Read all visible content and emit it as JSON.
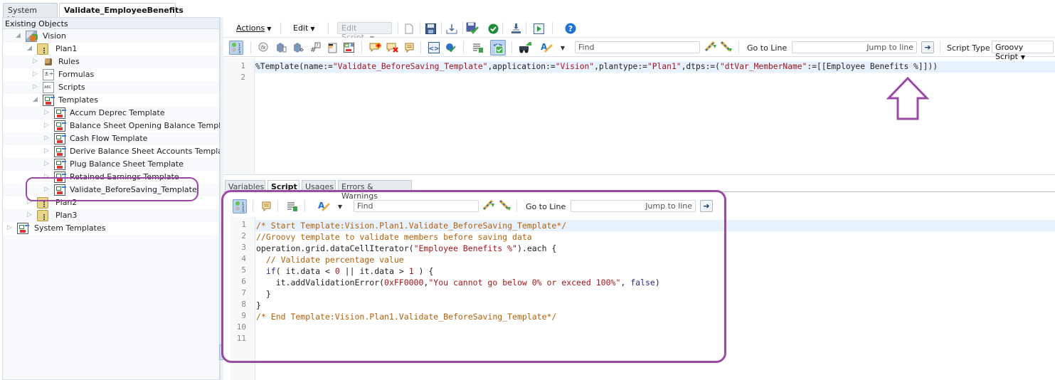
{
  "window_tabs": [
    {
      "label": "System View",
      "active": false
    },
    {
      "label": "Validate_EmployeeBenefits",
      "active": true
    }
  ],
  "left_panel": {
    "header": "Existing Objects",
    "tree": [
      {
        "label": "Vision",
        "level": 0,
        "expanded": true,
        "icon": "application-icon"
      },
      {
        "label": "Plan1",
        "level": 1,
        "expanded": true,
        "icon": "plan-icon"
      },
      {
        "label": "Rules",
        "level": 2,
        "expanded": false,
        "icon": "rules-icon"
      },
      {
        "label": "Formulas",
        "level": 2,
        "expanded": false,
        "icon": "formulas-icon"
      },
      {
        "label": "Scripts",
        "level": 2,
        "expanded": false,
        "icon": "scripts-icon"
      },
      {
        "label": "Templates",
        "level": 2,
        "expanded": true,
        "icon": "templates-icon"
      },
      {
        "label": "Accum Deprec Template",
        "level": 3,
        "expanded": false,
        "icon": "template-icon"
      },
      {
        "label": "Balance Sheet Opening Balance Template",
        "level": 3,
        "expanded": false,
        "icon": "template-icon"
      },
      {
        "label": "Cash Flow Template",
        "level": 3,
        "expanded": false,
        "icon": "template-icon"
      },
      {
        "label": "Derive Balance Sheet Accounts Template",
        "level": 3,
        "expanded": false,
        "icon": "template-icon"
      },
      {
        "label": "Plug Balance Sheet Template",
        "level": 3,
        "expanded": false,
        "icon": "template-icon"
      },
      {
        "label": "Retained Earnings Template",
        "level": 3,
        "expanded": false,
        "icon": "template-icon"
      },
      {
        "label": "Validate_BeforeSaving_Template",
        "level": 3,
        "expanded": false,
        "icon": "template-icon",
        "highlighted": true
      },
      {
        "label": "Plan2",
        "level": 1,
        "expanded": false,
        "icon": "plan-icon"
      },
      {
        "label": "Plan3",
        "level": 1,
        "expanded": false,
        "icon": "plan-icon"
      },
      {
        "label": "System Templates",
        "level": 0,
        "expanded": false,
        "icon": "templates-icon"
      }
    ]
  },
  "toolbar_main": {
    "actions_label": "Actions",
    "edit_label": "Edit",
    "edit_script_label": "Edit Script",
    "icons": [
      "new-icon",
      "save-icon",
      "download-icon",
      "save-validate-icon",
      "validate-icon",
      "deploy-icon",
      "launch-icon",
      "help-icon"
    ]
  },
  "toolbar_editor": {
    "find_placeholder": "Find",
    "go_to_line_label": "Go to Line",
    "jump_placeholder": "Jump to line",
    "script_type_label": "Script Type",
    "script_type_value": "Groovy Script",
    "icons": [
      "line-numbers-icon",
      "function-icon",
      "member-icon",
      "member-range-icon",
      "variable-icon",
      "rtp-icon",
      "template-icon",
      "add-comment-icon",
      "remove-comment-icon",
      "comment-icon",
      "code-block-icon",
      "syntax-check-icon",
      "format-icon",
      "syntax-icon",
      "debug-icon",
      "color-theme-icon",
      "find-next-icon",
      "find-prev-icon",
      "go-icon"
    ]
  },
  "editor_top": {
    "lines": [
      {
        "n": "1",
        "parts": [
          {
            "t": "%Template(name:=",
            "c": ""
          },
          {
            "t": "\"Validate_BeforeSaving_Template\"",
            "c": "s"
          },
          {
            "t": ",application:=",
            "c": ""
          },
          {
            "t": "\"Vision\"",
            "c": "s"
          },
          {
            "t": ",plantype:=",
            "c": ""
          },
          {
            "t": "\"Plan1\"",
            "c": "s"
          },
          {
            "t": ",dtps:=(",
            "c": ""
          },
          {
            "t": "\"dtVar_MemberName\"",
            "c": "s"
          },
          {
            "t": ":=[[Employee Benefits %]]))",
            "c": ""
          }
        ]
      },
      {
        "n": "2",
        "parts": []
      }
    ]
  },
  "sub_tabs": [
    {
      "label": "Variables",
      "active": false
    },
    {
      "label": "Script",
      "active": true
    },
    {
      "label": "Usages",
      "active": false
    },
    {
      "label": "Errors & Warnings",
      "active": false
    }
  ],
  "toolbar_script": {
    "find_placeholder": "Find",
    "go_to_line_label": "Go to Line",
    "jump_placeholder": "Jump to line"
  },
  "editor_bottom": {
    "lines": [
      {
        "n": "1",
        "parts": [
          {
            "t": "/* Start Template:Vision.Plan1.Validate_BeforeSaving_Template*/",
            "c": "cm"
          }
        ]
      },
      {
        "n": "2",
        "parts": [
          {
            "t": "//Groovy template to validate members before saving data",
            "c": "cm"
          }
        ]
      },
      {
        "n": "3",
        "parts": [
          {
            "t": "operation.grid.dataCellIterator(",
            "c": ""
          },
          {
            "t": "\"Employee Benefits %\"",
            "c": "s"
          },
          {
            "t": ").each {",
            "c": ""
          }
        ]
      },
      {
        "n": "4",
        "parts": [
          {
            "t": "  // Validate percentage value",
            "c": "cm"
          }
        ]
      },
      {
        "n": "5",
        "parts": [
          {
            "t": "  ",
            "c": ""
          },
          {
            "t": "if",
            "c": "kw"
          },
          {
            "t": "( it.data < ",
            "c": ""
          },
          {
            "t": "0",
            "c": "s"
          },
          {
            "t": " || it.data > ",
            "c": ""
          },
          {
            "t": "1",
            "c": "s"
          },
          {
            "t": " ) {",
            "c": ""
          }
        ]
      },
      {
        "n": "6",
        "parts": [
          {
            "t": "    it.addValidationError(",
            "c": ""
          },
          {
            "t": "0xFF0000",
            "c": "s"
          },
          {
            "t": ",",
            "c": ""
          },
          {
            "t": "\"You cannot go below 0% or exceed 100%\"",
            "c": "s"
          },
          {
            "t": ", ",
            "c": ""
          },
          {
            "t": "false",
            "c": "kw"
          },
          {
            "t": ")",
            "c": ""
          }
        ]
      },
      {
        "n": "7",
        "parts": [
          {
            "t": "  }",
            "c": ""
          }
        ]
      },
      {
        "n": "8",
        "parts": [
          {
            "t": "}",
            "c": ""
          }
        ]
      },
      {
        "n": "9",
        "parts": [
          {
            "t": "/* End Template:Vision.Plan1.Validate_BeforeSaving_Template*/",
            "c": "cm"
          }
        ]
      },
      {
        "n": "10",
        "parts": []
      },
      {
        "n": "11",
        "parts": []
      }
    ]
  },
  "colors": {
    "annotation": "#9b4aa3",
    "string": "#a3151b",
    "comment": "#b45f06",
    "active_line": "#e8f2fe"
  }
}
